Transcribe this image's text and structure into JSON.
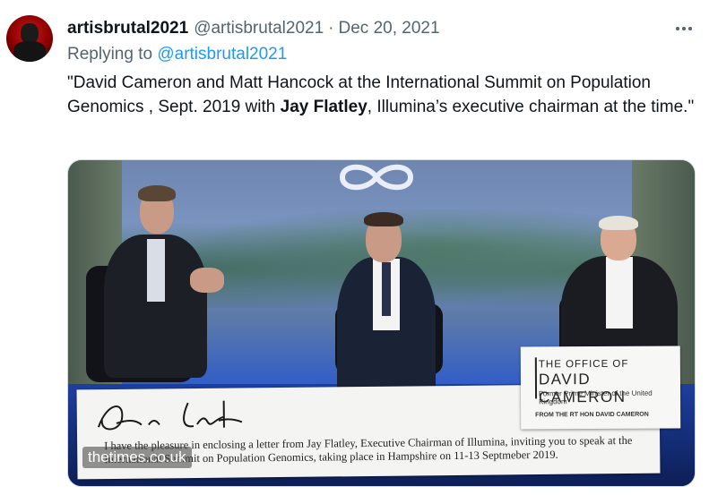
{
  "tweet": {
    "display_name": "artisbrutal2021",
    "handle": "@artisbrutal2021",
    "separator": "·",
    "date": "Dec 20, 2021",
    "reply_prefix": "Replying to",
    "reply_to": "@artisbrutal2021",
    "text_part1": "\"David Cameron and Matt Hancock at the International Summit on Population Genomics , Sept. 2019 with ",
    "text_bold": "Jay Flatley",
    "text_part2": ", Illumina’s executive chairman at the time.\"",
    "more_icon": "more-horizontal-icon"
  },
  "media": {
    "letter_text": "I have the pleasure in enclosing a letter from Jay Flatley, Executive Chairman of Illumina, inviting you to speak at the International Summit on Population Genomics, taking place in Hampshire on 11-13 Septmeber 2019.",
    "card_line1": "THE OFFICE OF",
    "card_line2": "DAVID CAMERON",
    "card_line3": "Former Prime Minister of the United Kingdom",
    "card_line4": "FROM THE RT HON DAVID CAMERON",
    "watermark": "thetimes.co.uk"
  },
  "colors": {
    "accent": "#1d9bf0",
    "secondary_text": "#536471",
    "primary_text": "#0f1419"
  }
}
